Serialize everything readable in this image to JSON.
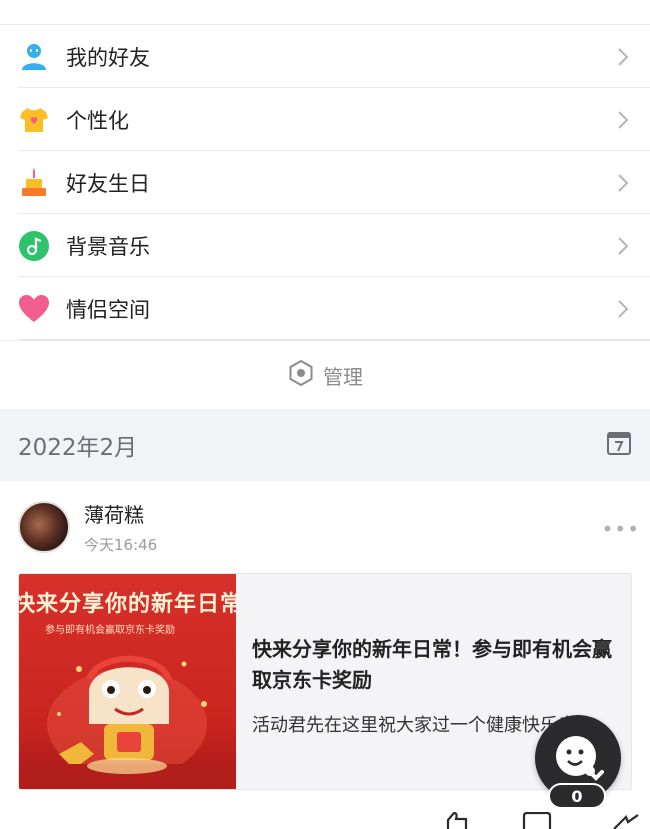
{
  "menu": {
    "items": [
      {
        "label": "我的好友",
        "icon": "friend-icon"
      },
      {
        "label": "个性化",
        "icon": "tshirt-icon"
      },
      {
        "label": "好友生日",
        "icon": "cake-icon"
      },
      {
        "label": "背景音乐",
        "icon": "music-icon"
      },
      {
        "label": "情侣空间",
        "icon": "heart-icon"
      }
    ]
  },
  "manage": {
    "label": "管理"
  },
  "timeline": {
    "month": "2022年2月"
  },
  "post": {
    "username": "薄荷糕",
    "time": "今天16:46",
    "card": {
      "title": "快来分享你的新年日常！参与即有机会赢取京东卡奖励",
      "description": "活动君先在这里祝大家过一个健康快乐幸",
      "thumb_title": "快来分享你的新年日常",
      "thumb_subtitle": "参与即有机会赢取京东卡奖励"
    }
  },
  "fab": {
    "count": "0"
  },
  "colors": {
    "accent_blue": "#2fa8f0",
    "music_green": "#2cc36b",
    "heart_pink": "#f25d8e",
    "thumb_red": "#d8302b",
    "divider": "#e8e8ea",
    "section_bg": "#f2f3f7"
  }
}
